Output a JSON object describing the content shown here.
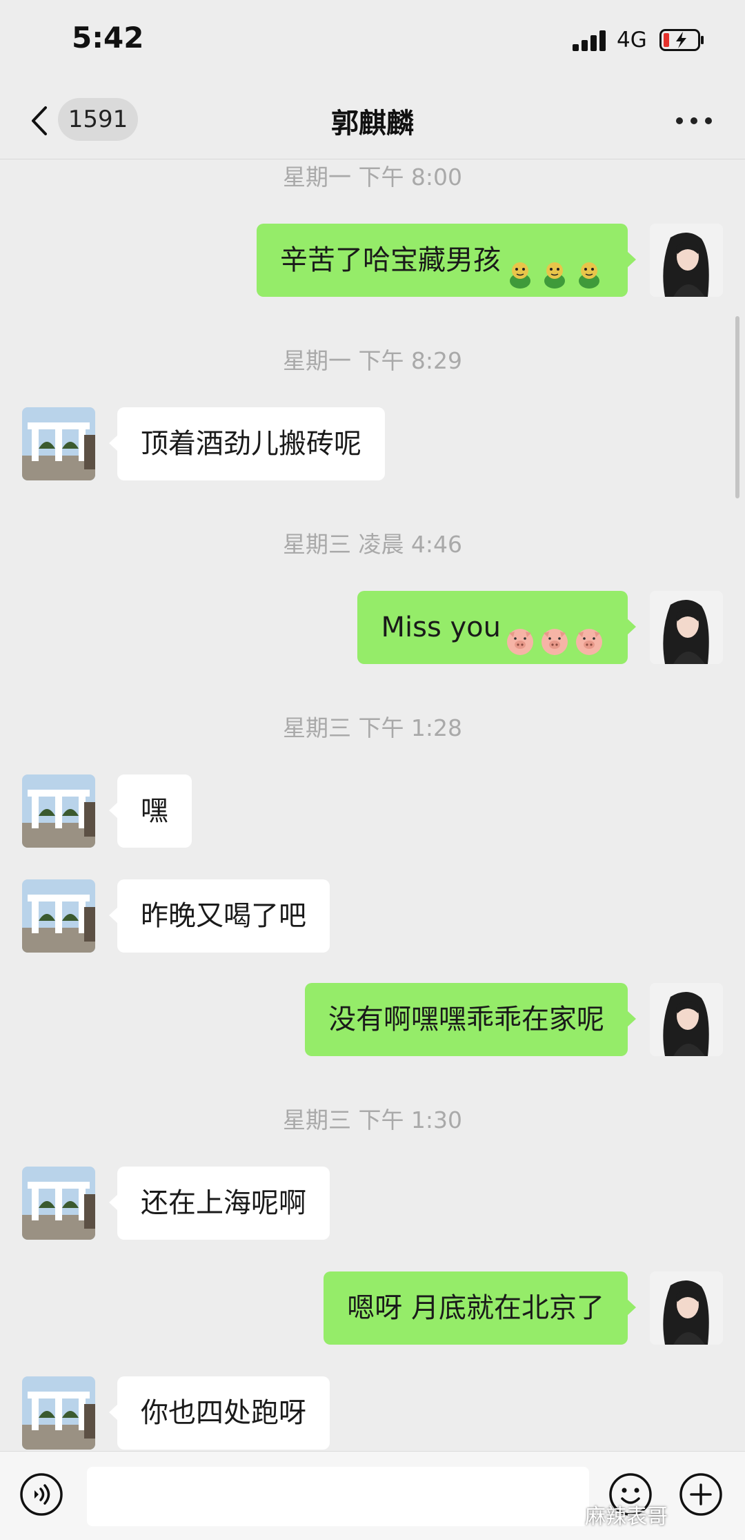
{
  "status_bar": {
    "time": "5:42",
    "network": "4G"
  },
  "header": {
    "back_count": "1591",
    "title": "郭麒麟"
  },
  "messages": [
    {
      "type": "timestamp",
      "text": "星期一 下午 8:00"
    },
    {
      "type": "sent",
      "text": "辛苦了哈宝藏男孩",
      "emoji": [
        "frog-emoji",
        "frog-emoji",
        "frog-emoji"
      ]
    },
    {
      "type": "timestamp",
      "text": "星期一 下午 8:29"
    },
    {
      "type": "received",
      "text": "顶着酒劲儿搬砖呢"
    },
    {
      "type": "timestamp",
      "text": "星期三 凌晨 4:46"
    },
    {
      "type": "sent",
      "text": "Miss you",
      "emoji": [
        "pig-emoji",
        "pig-emoji",
        "pig-emoji"
      ]
    },
    {
      "type": "timestamp",
      "text": "星期三 下午 1:28"
    },
    {
      "type": "received",
      "text": "嘿"
    },
    {
      "type": "received",
      "text": "昨晚又喝了吧"
    },
    {
      "type": "sent",
      "text": "没有啊嘿嘿乖乖在家呢"
    },
    {
      "type": "timestamp",
      "text": "星期三 下午 1:30"
    },
    {
      "type": "received",
      "text": "还在上海呢啊"
    },
    {
      "type": "sent",
      "text": "嗯呀 月底就在北京了"
    },
    {
      "type": "received",
      "text": "你也四处跑呀"
    }
  ],
  "watermark": "麻辣表哥",
  "colors": {
    "background": "#ededed",
    "sent_bubble": "#95ec69",
    "received_bubble": "#ffffff",
    "timestamp": "#a9a9a9"
  }
}
